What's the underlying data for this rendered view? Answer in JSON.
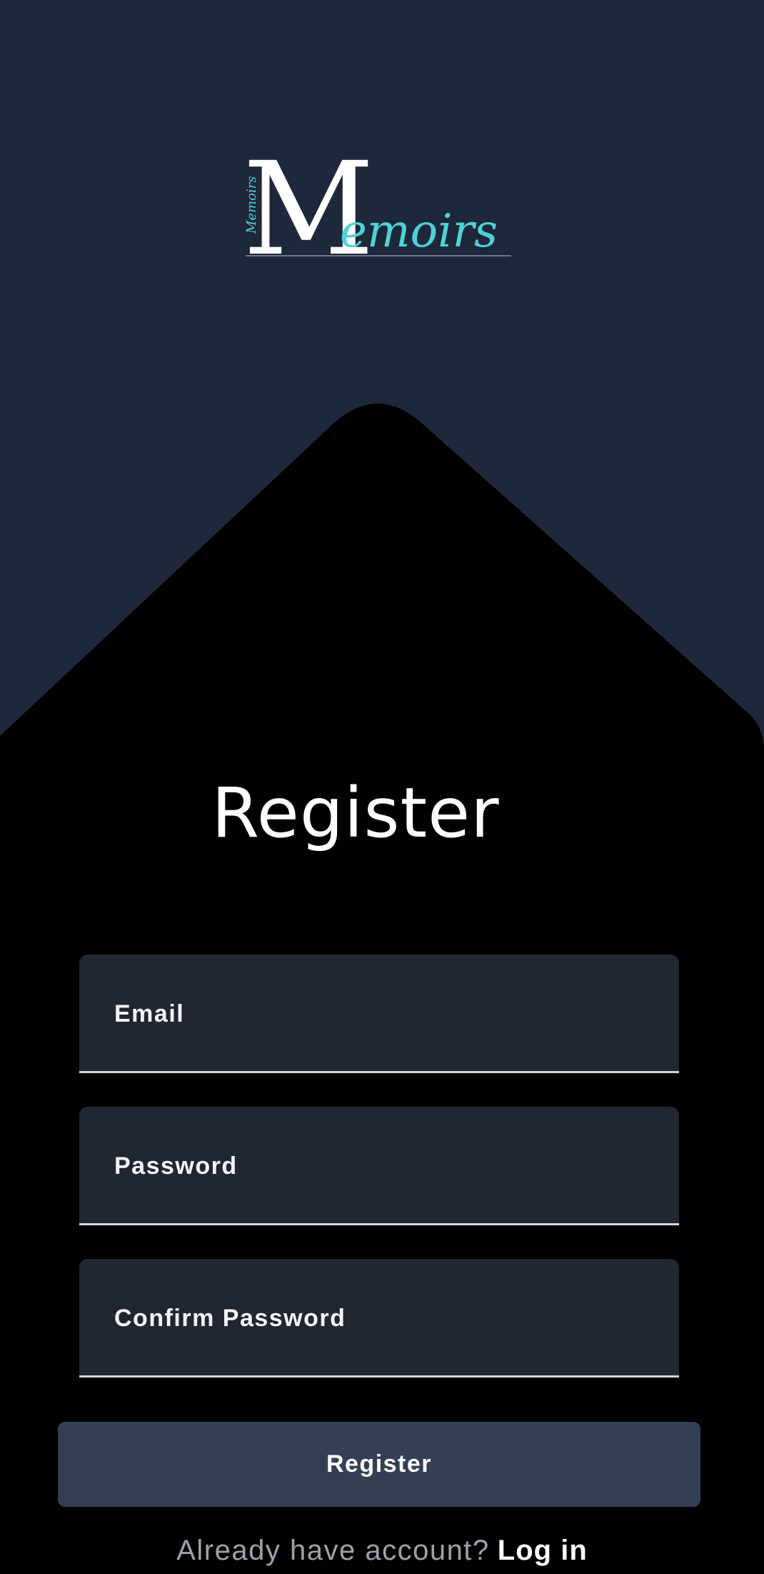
{
  "colors": {
    "top_background": "#1e283b",
    "form_background": "#000000",
    "field_background": "#202632",
    "button_background": "#333f55",
    "logo_accent": "#4fd3d7"
  },
  "logo": {
    "letter": "M",
    "script_text": "emoirs",
    "vertical_text": "Memoirs"
  },
  "page": {
    "title": "Register"
  },
  "form": {
    "email_label": "Email",
    "password_label": "Password",
    "confirm_password_label": "Confirm Password",
    "submit_label": "Register"
  },
  "footer": {
    "prompt": "Already have account?",
    "link": "Log in"
  }
}
